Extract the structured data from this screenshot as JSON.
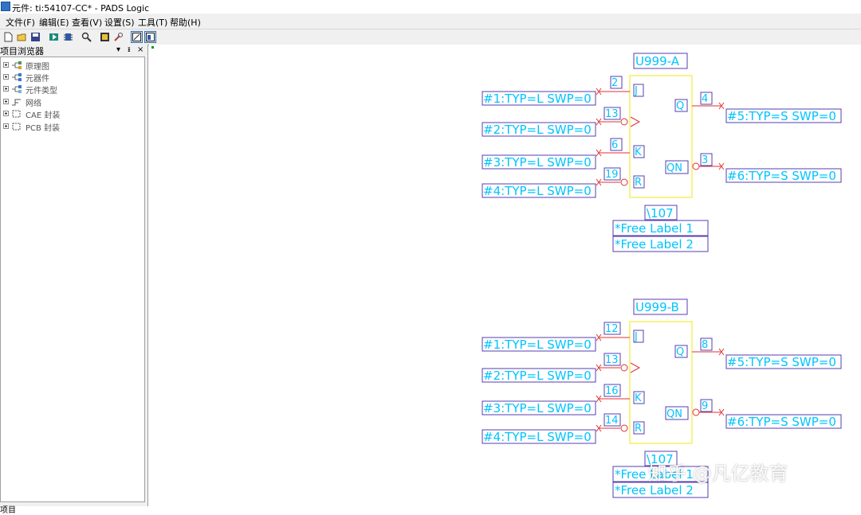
{
  "window": {
    "title": "元件: ti:54107-CC* - PADS Logic"
  },
  "menu": [
    "文件(F)",
    "编辑(E)",
    "查看(V)",
    "设置(S)",
    "工具(T)",
    "帮助(H)"
  ],
  "panel": {
    "title": "项目浏览器",
    "controls": [
      "▾",
      "ᵻ",
      "×"
    ],
    "tree": [
      "原理图",
      "元器件",
      "元件类型",
      "网络",
      "CAE 封装",
      "PCB 封装"
    ],
    "bottom_tab": "项目"
  },
  "parts": [
    {
      "refdes": "U999-A",
      "left_pins": [
        {
          "num": "2",
          "name": "J",
          "net": "#1:TYP=L SWP=0",
          "bubble": false
        },
        {
          "num": "13",
          "name": ">",
          "net": "#2:TYP=L SWP=0",
          "bubble": true
        },
        {
          "num": "6",
          "name": "K",
          "net": "#3:TYP=L SWP=0",
          "bubble": false
        },
        {
          "num": "19",
          "name": "R",
          "net": "#4:TYP=L SWP=0",
          "bubble": true
        }
      ],
      "right_pins": [
        {
          "num": "4",
          "name": "Q",
          "net": "#5:TYP=S SWP=0",
          "bubble": false
        },
        {
          "num": "3",
          "name": "QN",
          "net": "#6:TYP=S SWP=0",
          "bubble": true
        }
      ],
      "part_type": "\\107",
      "free_labels": [
        "*Free Label 1",
        "*Free Label 2"
      ]
    },
    {
      "refdes": "U999-B",
      "left_pins": [
        {
          "num": "12",
          "name": "J",
          "net": "#1:TYP=L SWP=0",
          "bubble": false
        },
        {
          "num": "13",
          "name": ">",
          "net": "#2:TYP=L SWP=0",
          "bubble": true
        },
        {
          "num": "16",
          "name": "K",
          "net": "#3:TYP=L SWP=0",
          "bubble": false
        },
        {
          "num": "14",
          "name": "R",
          "net": "#4:TYP=L SWP=0",
          "bubble": true
        }
      ],
      "right_pins": [
        {
          "num": "8",
          "name": "Q",
          "net": "#5:TYP=S SWP=0",
          "bubble": false
        },
        {
          "num": "9",
          "name": "QN",
          "net": "#6:TYP=S SWP=0",
          "bubble": true
        }
      ],
      "part_type": "\\107",
      "free_labels": [
        "*Free Label 1",
        "*Free Label 2"
      ]
    }
  ],
  "watermark": "知乎 @凡亿教育",
  "colors": {
    "label": "#00c4ff",
    "pin": "#e03030",
    "body": "#f5ef60",
    "box": "#5a3cb0"
  }
}
